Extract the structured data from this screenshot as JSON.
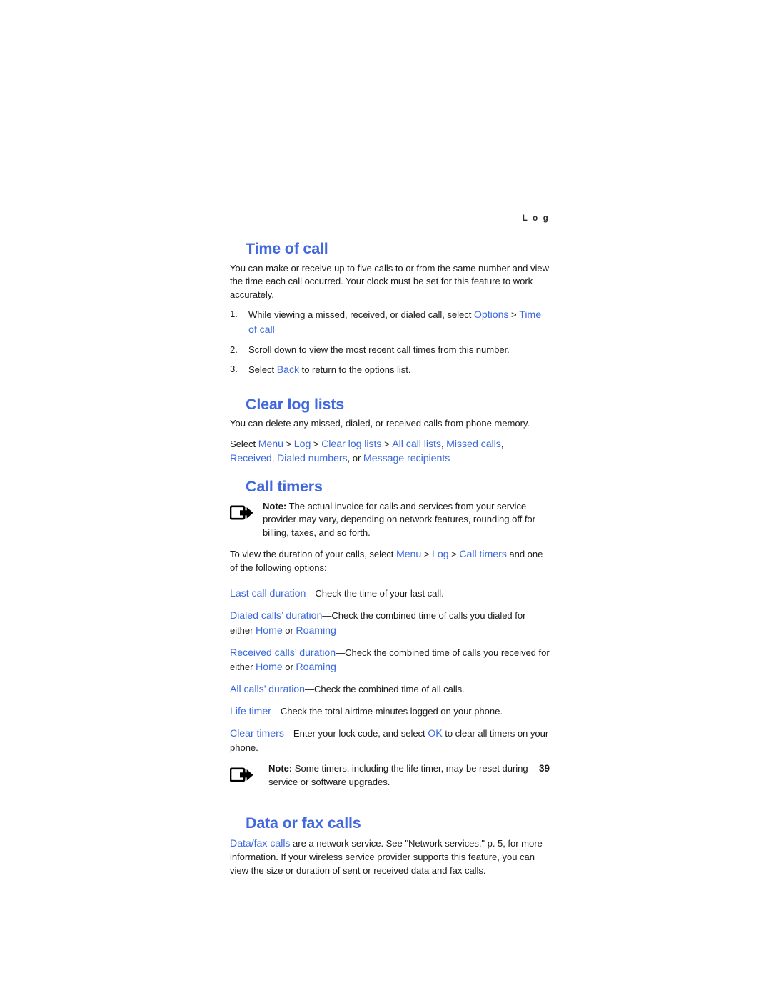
{
  "page": {
    "running_head": "L o g",
    "page_number": "39",
    "heading_color": "#4268e0",
    "link_color": "#3a68dd",
    "body_color": "#1a1a1a"
  },
  "sections": [
    {
      "id": "time-of-call",
      "heading": "Time of call",
      "intro": "You can make or receive up to five calls to or from the same number and view the time each call occurred. Your clock must be set for this feature to work accurately.",
      "steps": [
        {
          "num": "1.",
          "pre": "While viewing a missed, received, or dialed call, select ",
          "link1": "Options",
          "sep": " > ",
          "link2": "Time of call",
          "post": ""
        },
        {
          "num": "2.",
          "pre": "Scroll down to view the most recent call times from this number.",
          "link1": "",
          "sep": "",
          "link2": "",
          "post": ""
        },
        {
          "num": "3.",
          "pre": "Select ",
          "link1": "Back",
          "sep": "",
          "link2": "",
          "post": " to return to the options list."
        }
      ]
    },
    {
      "id": "clear-log-lists",
      "heading": "Clear log lists",
      "intro": "You can delete any missed, dialed, or received calls from phone memory.",
      "select_line": {
        "lead": "Select ",
        "path": [
          "Menu",
          "Log",
          "Clear log lists",
          "All call lists"
        ],
        "path_separator": " > ",
        "options": [
          "Missed calls",
          "Received",
          "Dialed numbers"
        ],
        "conjunction": ", or ",
        "final_option": "Message recipients"
      }
    },
    {
      "id": "call-timers",
      "heading": "Call timers",
      "note": {
        "icon": "note-arrow-icon",
        "label": "Note:",
        "text": " The actual invoice for calls and services from your service provider may vary, depending on network features, rounding off for billing, taxes, and so forth."
      },
      "intro_pre": "To view the duration of your calls, select ",
      "intro_path": [
        "Menu",
        "Log",
        "Call timers"
      ],
      "intro_post": " and one of the following options:",
      "options": [
        {
          "term": "Last call duration",
          "dash": "—",
          "desc": "Check the time of your last call.",
          "desc_tail": "",
          "sub_link1": "",
          "sub_mid": "",
          "sub_link2": ""
        },
        {
          "term": "Dialed calls’ duration",
          "dash": "—",
          "desc": "Check the combined time of calls you dialed for either ",
          "desc_tail": "",
          "sub_link1": "Home",
          "sub_mid": " or ",
          "sub_link2": "Roaming"
        },
        {
          "term": "Received calls’ duration",
          "dash": "—",
          "desc": "Check the combined time of calls you received for either ",
          "desc_tail": "",
          "sub_link1": "Home",
          "sub_mid": " or ",
          "sub_link2": "Roaming"
        },
        {
          "term": "All calls’ duration",
          "dash": "—",
          "desc": "Check the combined time of all calls.",
          "desc_tail": "",
          "sub_link1": "",
          "sub_mid": "",
          "sub_link2": ""
        },
        {
          "term": "Life timer",
          "dash": "—",
          "desc": "Check the total airtime minutes logged on your phone.",
          "desc_tail": "",
          "sub_link1": "",
          "sub_mid": "",
          "sub_link2": ""
        },
        {
          "term": "Clear timers",
          "dash": "—",
          "desc": "Enter your lock code, and select ",
          "desc_tail": " to clear all timers on your phone.",
          "sub_link1": "OK",
          "sub_mid": "",
          "sub_link2": ""
        }
      ],
      "note2": {
        "icon": "note-arrow-icon",
        "label": "Note:",
        "text": " Some timers, including the life timer, may be reset during service or software upgrades."
      }
    },
    {
      "id": "data-or-fax-calls",
      "heading": "Data or fax calls",
      "lead_link": "Data/fax calls",
      "body": " are a network service. See \"Network services,\" p. 5, for more information. If your wireless service provider supports this feature, you can view the size or duration of sent or received data and fax calls."
    }
  ]
}
